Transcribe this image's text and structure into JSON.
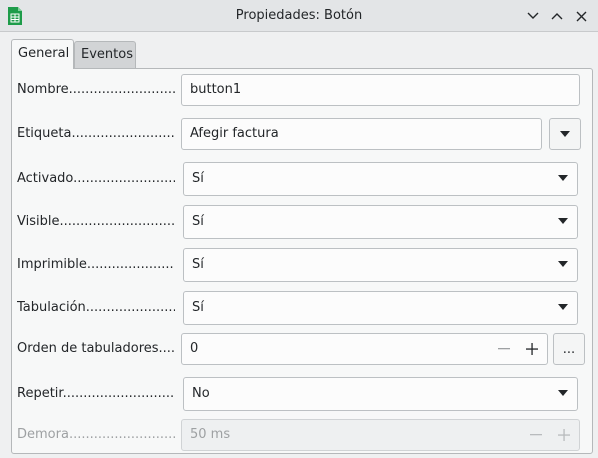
{
  "window": {
    "title": "Propiedades: Botón"
  },
  "tabs": [
    {
      "label": "General"
    },
    {
      "label": "Eventos"
    }
  ],
  "rows": {
    "nombre": {
      "label": "Nombre",
      "value": "button1"
    },
    "etiqueta": {
      "label": "Etiqueta",
      "value": "Afegir factura"
    },
    "activado": {
      "label": "Activado",
      "value": "Sí"
    },
    "visible": {
      "label": "Visible",
      "value": "Sí"
    },
    "imprimible": {
      "label": "Imprimible",
      "value": "Sí"
    },
    "tabulacion": {
      "label": "Tabulación",
      "value": "Sí"
    },
    "orden": {
      "label": "Orden de tabuladores",
      "value": "0",
      "more_label": "..."
    },
    "repetir": {
      "label": "Repetir",
      "value": "No"
    },
    "demora": {
      "label": "Demora",
      "value": "50 ms"
    }
  },
  "colors": {
    "icon_green": "#1e9c4a",
    "accent": "#3daee9"
  }
}
